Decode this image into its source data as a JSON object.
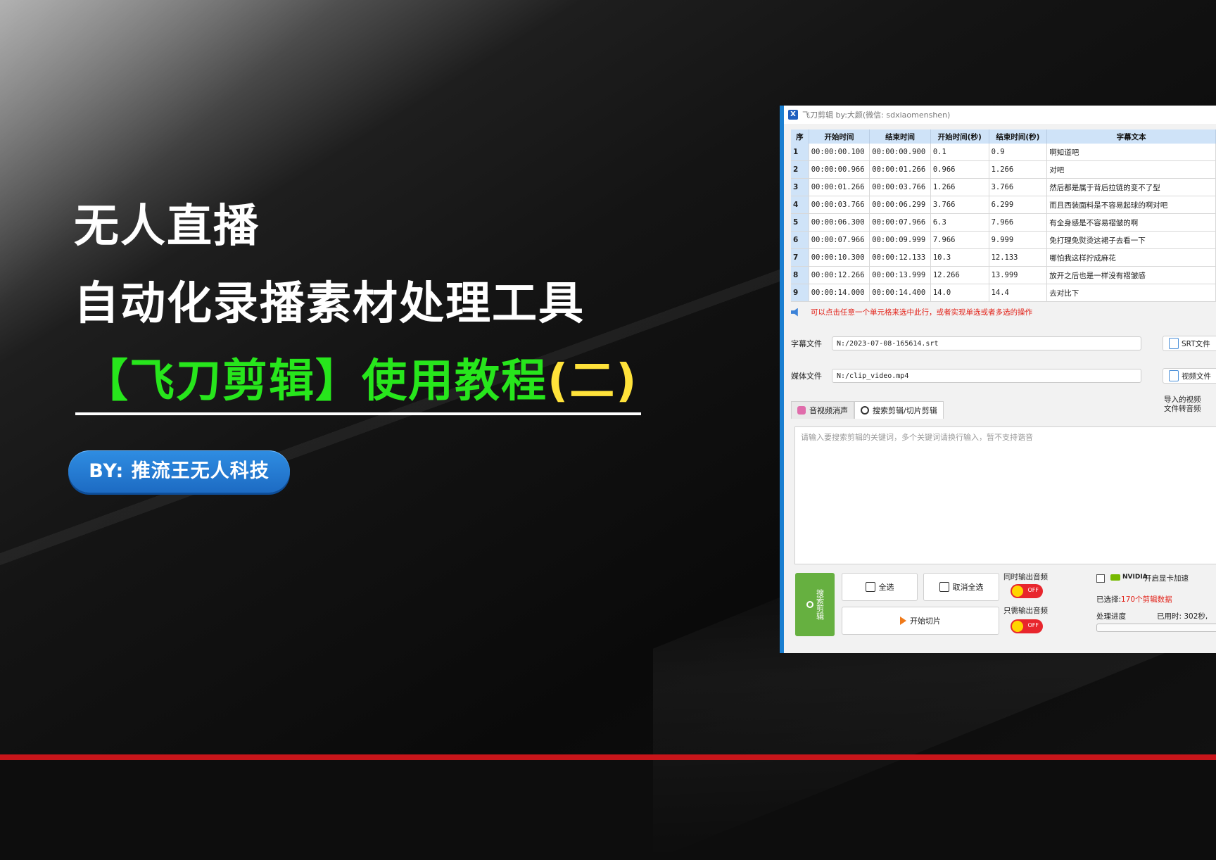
{
  "hero": {
    "title_line1": "无人直播",
    "title_line2": "自动化录播素材处理工具",
    "title_line3_main": "【飞刀剪辑】使用教程",
    "title_line3_suffix": "(二)",
    "byline": "BY: 推流王无人科技"
  },
  "window": {
    "icon_letter": "X",
    "title": "飞刀剪辑 by:大颜(微信: sdxiaomenshen)"
  },
  "table": {
    "headers": [
      "序",
      "开始时间",
      "结束时间",
      "开始时间(秒)",
      "结束时间(秒)",
      "字幕文本"
    ],
    "rows": [
      [
        "1",
        "00:00:00.100",
        "00:00:00.900",
        "0.1",
        "0.9",
        "啊知道吧"
      ],
      [
        "2",
        "00:00:00.966",
        "00:00:01.266",
        "0.966",
        "1.266",
        "对吧"
      ],
      [
        "3",
        "00:00:01.266",
        "00:00:03.766",
        "1.266",
        "3.766",
        "然后都是属于背后拉链的变不了型"
      ],
      [
        "4",
        "00:00:03.766",
        "00:00:06.299",
        "3.766",
        "6.299",
        "而且西装面料是不容易起球的啊对吧"
      ],
      [
        "5",
        "00:00:06.300",
        "00:00:07.966",
        "6.3",
        "7.966",
        "有全身感是不容易褶皱的啊"
      ],
      [
        "6",
        "00:00:07.966",
        "00:00:09.999",
        "7.966",
        "9.999",
        "免打理免熨烫这裙子去看一下"
      ],
      [
        "7",
        "00:00:10.300",
        "00:00:12.133",
        "10.3",
        "12.133",
        "哪怕我这样拧成麻花"
      ],
      [
        "8",
        "00:00:12.266",
        "00:00:13.999",
        "12.266",
        "13.999",
        "放开之后也是一样没有褶皱感"
      ],
      [
        "9",
        "00:00:14.000",
        "00:00:14.400",
        "14.0",
        "14.4",
        "去对比下"
      ]
    ]
  },
  "hint": "可以点击任意一个单元格来选中此行，或者实现单选或者多选的操作",
  "subtitle_file": {
    "label": "字幕文件",
    "value": "N:/2023-07-08-165614.srt",
    "button": "SRT文件"
  },
  "media_file": {
    "label": "媒体文件",
    "value": "N:/clip_video.mp4",
    "button": "视频文件"
  },
  "tabs": [
    "音视频消声",
    "搜索剪辑/切片剪辑"
  ],
  "import_note": [
    "导入的视频",
    "文件转音频"
  ],
  "search_placeholder": "请输入要搜索剪辑的关键词，多个关键词请换行输入，暂不支持谐音",
  "actions": {
    "search": "搜索剪辑",
    "select_all": "全选",
    "deselect_all": "取消全选",
    "start_cut": "开始切片"
  },
  "toggles": {
    "audio_also_label": "同时输出音频",
    "audio_only_label": "只需输出音频",
    "state": "OFF"
  },
  "gpu": {
    "brand": "NVIDIA",
    "label": "开启显卡加速"
  },
  "status": {
    "selected_prefix": "已选择:",
    "selected_value": "170个剪辑数据",
    "progress_label": "处理进度",
    "elapsed": "已用时: 302秒,"
  },
  "colors": {
    "accent_green": "#27e61c",
    "accent_yellow": "#ffe23a",
    "badge_blue": "#2f8de2",
    "window_border": "#1a7fd1",
    "bottom_bar": "#c8151a"
  }
}
